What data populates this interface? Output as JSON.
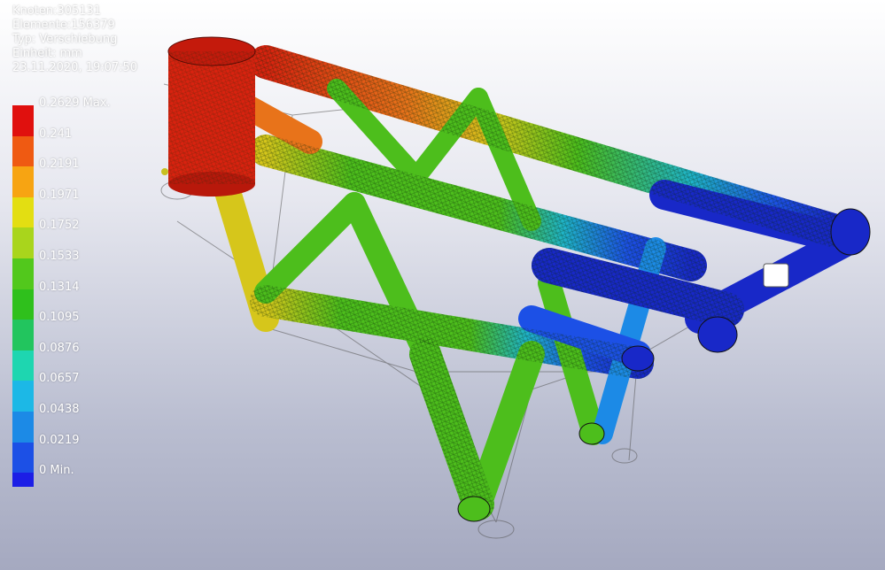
{
  "info": {
    "nodes": "Knoten:305131",
    "elements": "Elemente:156379",
    "type": "Typ: Verschiebung",
    "unit": "Einheit: mm",
    "timestamp": "23.11.2020, 19:07:50"
  },
  "legend": {
    "labels": [
      "0.2629 Max.",
      "0.241",
      "0.2191",
      "0.1971",
      "0.1752",
      "0.1533",
      "0.1314",
      "0.1095",
      "0.0876",
      "0.0657",
      "0.0438",
      "0.0219",
      "0 Min."
    ],
    "colors": [
      "#e0100e",
      "#ef5a12",
      "#f7a412",
      "#e3de12",
      "#a9d51c",
      "#52c81c",
      "#2fc01c",
      "#22c55e",
      "#1ed6b0",
      "#1cb8e6",
      "#1c8ae6",
      "#1c50e6",
      "#1c1ee6"
    ]
  },
  "model": {
    "description_icon": "fea-frame-mesh-icon",
    "colors": {
      "max": "#d9220f",
      "high": "#e8731a",
      "mid_high": "#d6c61b",
      "mid": "#4dbe1c",
      "low": "#1fb3c8",
      "min": "#1828c8"
    }
  }
}
